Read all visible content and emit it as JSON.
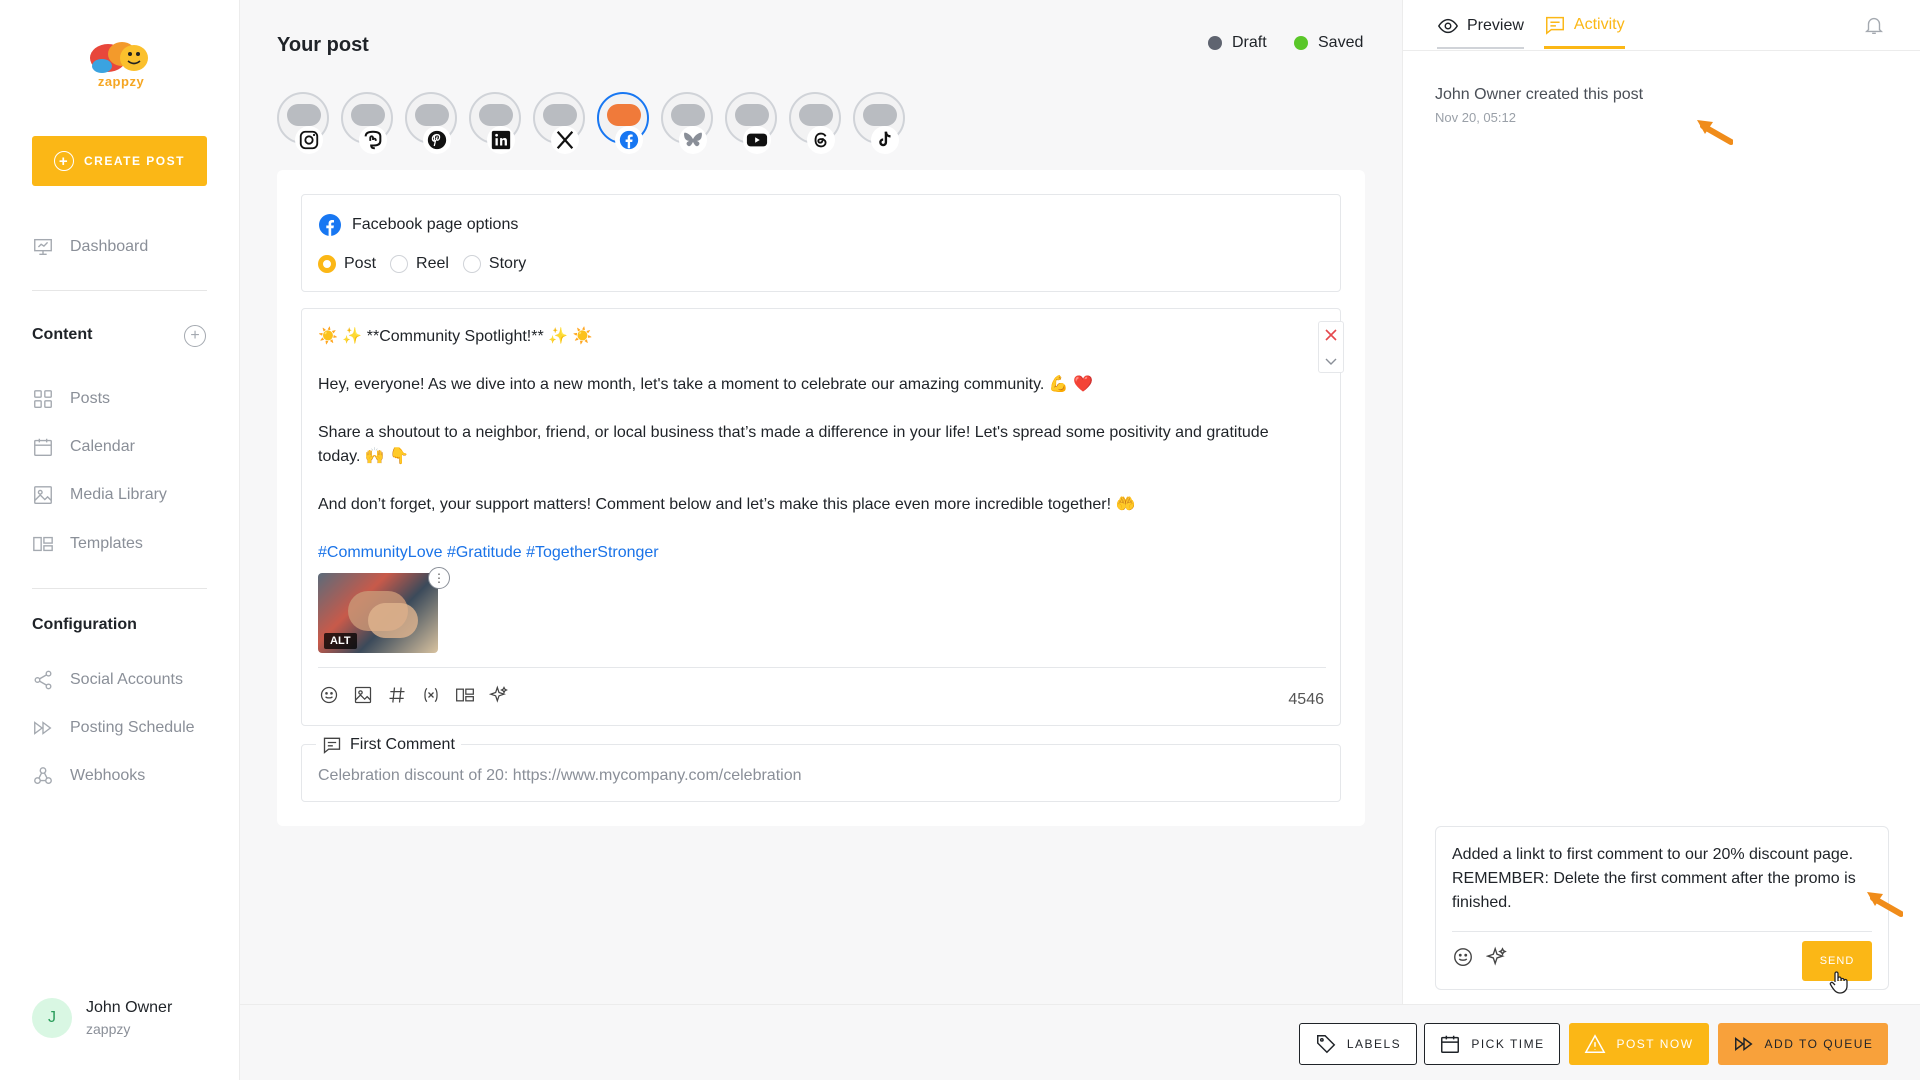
{
  "brand": {
    "logo_text": "zappzy",
    "accent": "#fbb716"
  },
  "sidebar": {
    "create_label": "CREATE POST",
    "dashboard_label": "Dashboard",
    "content_title": "Content",
    "content_items": [
      "Posts",
      "Calendar",
      "Media Library",
      "Templates"
    ],
    "config_title": "Configuration",
    "config_items": [
      "Social Accounts",
      "Posting Schedule",
      "Webhooks"
    ],
    "user": {
      "initial": "J",
      "name": "John Owner",
      "org": "zappzy"
    }
  },
  "main": {
    "title": "Your post",
    "status": [
      {
        "label": "Draft",
        "color": "#5f6470"
      },
      {
        "label": "Saved",
        "color": "#5ac729"
      }
    ],
    "accounts": [
      "instagram",
      "mastodon",
      "pinterest",
      "linkedin",
      "x",
      "facebook",
      "bluesky",
      "youtube",
      "threads",
      "tiktok"
    ],
    "active_account": "facebook",
    "fb_options": {
      "title": "Facebook page options",
      "options": [
        "Post",
        "Reel",
        "Story"
      ],
      "selected": "Post"
    },
    "post": {
      "line1": "☀️ ✨ **Community Spotlight!** ✨ ☀️",
      "line2": "Hey, everyone! As we dive into a new month, let's take a moment to celebrate our amazing community. 💪 ❤️",
      "line3": "Share a shoutout to a neighbor, friend, or local business that’s made a difference in your life! Let's spread some positivity and gratitude today. 🙌 👇",
      "line4": "And don’t forget, your support matters! Comment below and let’s make this place even more incredible together! 🤲",
      "hashtags": "#CommunityLove #Gratitude #TogetherStronger",
      "alt_label": "ALT",
      "char_count": "4546"
    },
    "first_comment": {
      "label": "First Comment",
      "value": "Celebration discount of 20: https://www.mycompany.com/celebration"
    }
  },
  "right": {
    "tab_preview": "Preview",
    "tab_activity": "Activity",
    "activity": {
      "text": "John Owner created this post",
      "time": "Nov 20, 05:12"
    },
    "compose_text": "Added a linkt to first comment to our 20% discount page. REMEMBER: Delete the first comment after the promo is finished.",
    "send_label": "SEND"
  },
  "bottom": {
    "labels": "LABELS",
    "pick_time": "PICK TIME",
    "post_now": "POST NOW",
    "add_queue": "ADD TO QUEUE"
  }
}
